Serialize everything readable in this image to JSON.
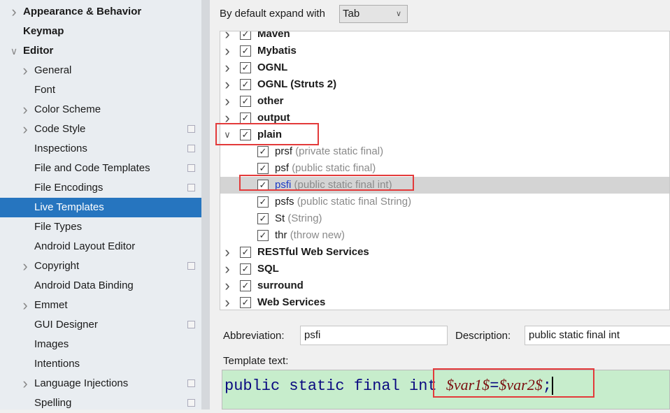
{
  "sidebar": {
    "items": [
      {
        "label": "Appearance & Behavior",
        "bold": true,
        "chevron": "right",
        "level": 0
      },
      {
        "label": "Keymap",
        "bold": true,
        "chevron": "",
        "level": 0
      },
      {
        "label": "Editor",
        "bold": true,
        "chevron": "down",
        "level": 0
      },
      {
        "label": "General",
        "chevron": "right",
        "level": 1
      },
      {
        "label": "Font",
        "chevron": "",
        "level": 1
      },
      {
        "label": "Color Scheme",
        "chevron": "right",
        "level": 1
      },
      {
        "label": "Code Style",
        "chevron": "right",
        "level": 1,
        "icon": true
      },
      {
        "label": "Inspections",
        "chevron": "",
        "level": 1,
        "icon": true
      },
      {
        "label": "File and Code Templates",
        "chevron": "",
        "level": 1,
        "icon": true
      },
      {
        "label": "File Encodings",
        "chevron": "",
        "level": 1,
        "icon": true
      },
      {
        "label": "Live Templates",
        "chevron": "",
        "level": 1,
        "selected": true
      },
      {
        "label": "File Types",
        "chevron": "",
        "level": 1
      },
      {
        "label": "Android Layout Editor",
        "chevron": "",
        "level": 1
      },
      {
        "label": "Copyright",
        "chevron": "right",
        "level": 1,
        "icon": true
      },
      {
        "label": "Android Data Binding",
        "chevron": "",
        "level": 1
      },
      {
        "label": "Emmet",
        "chevron": "right",
        "level": 1
      },
      {
        "label": "GUI Designer",
        "chevron": "",
        "level": 1,
        "icon": true
      },
      {
        "label": "Images",
        "chevron": "",
        "level": 1
      },
      {
        "label": "Intentions",
        "chevron": "",
        "level": 1
      },
      {
        "label": "Language Injections",
        "chevron": "right",
        "level": 1,
        "icon": true
      },
      {
        "label": "Spelling",
        "chevron": "",
        "level": 1,
        "icon": true
      }
    ]
  },
  "expand": {
    "label": "By default expand with",
    "value": "Tab"
  },
  "tree": [
    {
      "group": "Maven",
      "chevron": "right"
    },
    {
      "group": "Mybatis",
      "chevron": "right"
    },
    {
      "group": "OGNL",
      "chevron": "right"
    },
    {
      "group": "OGNL (Struts 2)",
      "chevron": "right"
    },
    {
      "group": "other",
      "chevron": "right"
    },
    {
      "group": "output",
      "chevron": "right"
    },
    {
      "group": "plain",
      "chevron": "down"
    },
    {
      "abbr": "prsf",
      "desc": "(private static final)"
    },
    {
      "abbr": "psf",
      "desc": "(public static final)"
    },
    {
      "abbr": "psfi",
      "desc": "(public static final int)",
      "selected": true
    },
    {
      "abbr": "psfs",
      "desc": "(public static final String)"
    },
    {
      "abbr": "St",
      "desc": "(String)"
    },
    {
      "abbr": "thr",
      "desc": "(throw new)"
    },
    {
      "group": "RESTful Web Services",
      "chevron": "right"
    },
    {
      "group": "SQL",
      "chevron": "right"
    },
    {
      "group": "surround",
      "chevron": "right"
    },
    {
      "group": "Web Services",
      "chevron": "right"
    }
  ],
  "form": {
    "abbreviation_label": "Abbreviation:",
    "abbreviation_value": "psfi",
    "description_label": "Description:",
    "description_value": "public static final int",
    "template_label": "Template text:",
    "template_prefix": "public static final int ",
    "template_var1": "$var1$",
    "template_eq": "=",
    "template_var2": "$var2$",
    "template_semi": ";"
  },
  "colors": {
    "selection": "#2675bf",
    "highlight_box": "#e33a3a",
    "template_bg": "#c7edcc"
  }
}
